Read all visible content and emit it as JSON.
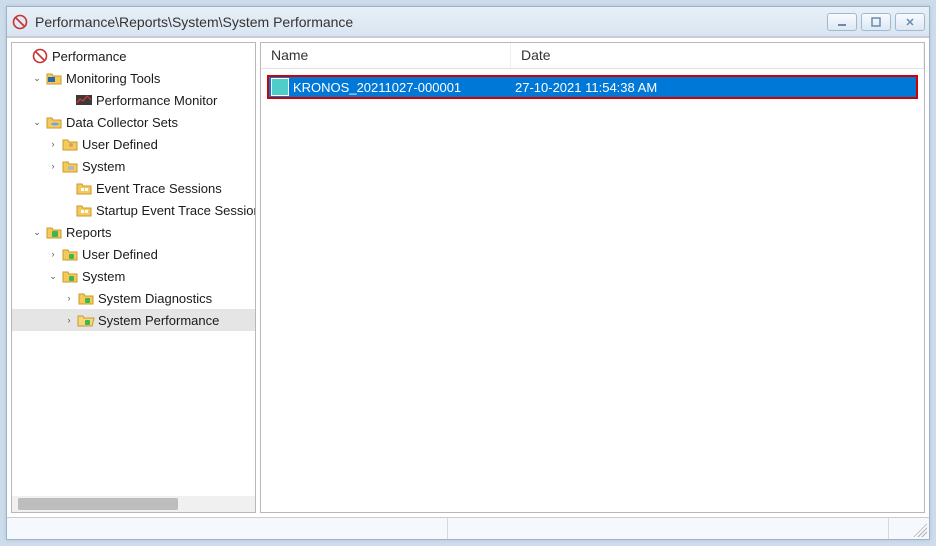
{
  "window": {
    "title": "Performance\\Reports\\System\\System Performance"
  },
  "tree": {
    "root": {
      "label": "Performance"
    },
    "monitoring_tools": {
      "label": "Monitoring Tools"
    },
    "performance_monitor": {
      "label": "Performance Monitor"
    },
    "dcs": {
      "label": "Data Collector Sets"
    },
    "dcs_user_defined": {
      "label": "User Defined"
    },
    "dcs_system": {
      "label": "System"
    },
    "dcs_ets": {
      "label": "Event Trace Sessions"
    },
    "dcs_sets": {
      "label": "Startup Event Trace Sessions"
    },
    "reports": {
      "label": "Reports"
    },
    "rep_user_defined": {
      "label": "User Defined"
    },
    "rep_system": {
      "label": "System"
    },
    "rep_sys_diag": {
      "label": "System Diagnostics"
    },
    "rep_sys_perf": {
      "label": "System Performance"
    }
  },
  "list": {
    "headers": {
      "name": "Name",
      "date": "Date"
    },
    "rows": [
      {
        "name": "KRONOS_20211027-000001",
        "date": "27-10-2021 11:54:38 AM"
      }
    ]
  }
}
